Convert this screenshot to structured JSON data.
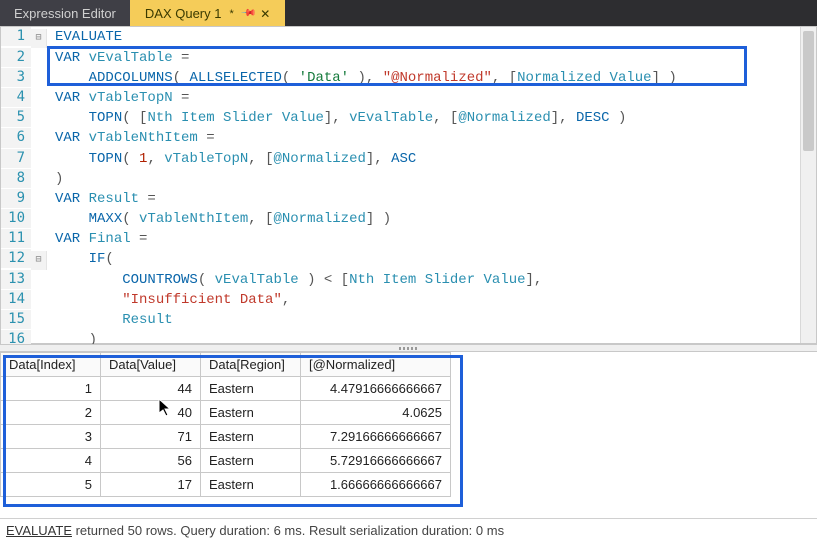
{
  "tabs": {
    "expression_editor": "Expression Editor",
    "active_tab": "DAX Query 1",
    "dirty_mark": "*"
  },
  "code": {
    "lines": [
      {
        "n": 1,
        "tokens": [
          [
            "kw",
            "EVALUATE"
          ]
        ]
      },
      {
        "n": 2,
        "tokens": [
          [
            "kw",
            "VAR "
          ],
          [
            "id",
            "vEvalTable"
          ],
          [
            "punc",
            " ="
          ]
        ]
      },
      {
        "n": 3,
        "tokens": [
          [
            "punc",
            "    "
          ],
          [
            "fn",
            "ADDCOLUMNS"
          ],
          [
            "punc",
            "( "
          ],
          [
            "fn",
            "ALLSELECTED"
          ],
          [
            "punc",
            "( "
          ],
          [
            "tbl",
            "'Data'"
          ],
          [
            "punc",
            " ), "
          ],
          [
            "str",
            "\"@Normalized\""
          ],
          [
            "punc",
            ", ["
          ],
          [
            "id",
            "Normalized Value"
          ],
          [
            "punc",
            "] )"
          ]
        ]
      },
      {
        "n": 4,
        "tokens": [
          [
            "kw",
            "VAR "
          ],
          [
            "id",
            "vTableTopN"
          ],
          [
            "punc",
            " ="
          ]
        ]
      },
      {
        "n": 5,
        "tokens": [
          [
            "punc",
            "    "
          ],
          [
            "fn",
            "TOPN"
          ],
          [
            "punc",
            "( ["
          ],
          [
            "id",
            "Nth Item Slider Value"
          ],
          [
            "punc",
            "], "
          ],
          [
            "id",
            "vEvalTable"
          ],
          [
            "punc",
            ", ["
          ],
          [
            "id",
            "@Normalized"
          ],
          [
            "punc",
            "], "
          ],
          [
            "kw",
            "DESC"
          ],
          [
            "punc",
            " )"
          ]
        ]
      },
      {
        "n": 6,
        "tokens": [
          [
            "kw",
            "VAR "
          ],
          [
            "id",
            "vTableNthItem"
          ],
          [
            "punc",
            " ="
          ]
        ]
      },
      {
        "n": 7,
        "tokens": [
          [
            "punc",
            "    "
          ],
          [
            "fn",
            "TOPN"
          ],
          [
            "punc",
            "( "
          ],
          [
            "num",
            "1"
          ],
          [
            "punc",
            ", "
          ],
          [
            "id",
            "vTableTopN"
          ],
          [
            "punc",
            ", ["
          ],
          [
            "id",
            "@Normalized"
          ],
          [
            "punc",
            "], "
          ],
          [
            "kw",
            "ASC"
          ]
        ]
      },
      {
        "n": 8,
        "tokens": [
          [
            "punc",
            ")"
          ]
        ]
      },
      {
        "n": 9,
        "tokens": [
          [
            "kw",
            "VAR "
          ],
          [
            "id",
            "Result"
          ],
          [
            "punc",
            " ="
          ]
        ]
      },
      {
        "n": 10,
        "tokens": [
          [
            "punc",
            "    "
          ],
          [
            "fn",
            "MAXX"
          ],
          [
            "punc",
            "( "
          ],
          [
            "id",
            "vTableNthItem"
          ],
          [
            "punc",
            ", ["
          ],
          [
            "id",
            "@Normalized"
          ],
          [
            "punc",
            "] )"
          ]
        ]
      },
      {
        "n": 11,
        "tokens": [
          [
            "kw",
            "VAR "
          ],
          [
            "id",
            "Final"
          ],
          [
            "punc",
            " ="
          ]
        ]
      },
      {
        "n": 12,
        "tokens": [
          [
            "punc",
            "    "
          ],
          [
            "fn",
            "IF"
          ],
          [
            "punc",
            "("
          ]
        ]
      },
      {
        "n": 13,
        "tokens": [
          [
            "punc",
            "        "
          ],
          [
            "fn",
            "COUNTROWS"
          ],
          [
            "punc",
            "( "
          ],
          [
            "id",
            "vEvalTable"
          ],
          [
            "punc",
            " ) < ["
          ],
          [
            "id",
            "Nth Item Slider Value"
          ],
          [
            "punc",
            "],"
          ]
        ]
      },
      {
        "n": 14,
        "tokens": [
          [
            "punc",
            "        "
          ],
          [
            "str",
            "\"Insufficient Data\""
          ],
          [
            "punc",
            ","
          ]
        ]
      },
      {
        "n": 15,
        "tokens": [
          [
            "punc",
            "        "
          ],
          [
            "id",
            "Result"
          ]
        ]
      },
      {
        "n": 16,
        "tokens": [
          [
            "punc",
            "    )"
          ]
        ]
      }
    ]
  },
  "grid": {
    "headers": [
      "Data[Index]",
      "Data[Value]",
      "Data[Region]",
      "[@Normalized]"
    ],
    "rows": [
      {
        "index": "1",
        "value": "44",
        "region": "Eastern",
        "norm": "4.47916666666667"
      },
      {
        "index": "2",
        "value": "40",
        "region": "Eastern",
        "norm": "4.0625"
      },
      {
        "index": "3",
        "value": "71",
        "region": "Eastern",
        "norm": "7.29166666666667"
      },
      {
        "index": "4",
        "value": "56",
        "region": "Eastern",
        "norm": "5.72916666666667"
      },
      {
        "index": "5",
        "value": "17",
        "region": "Eastern",
        "norm": "1.66666666666667"
      }
    ]
  },
  "status": {
    "link": "EVALUATE",
    "text": " returned 50 rows. Query duration: 6 ms. Result serialization duration: 0 ms"
  }
}
